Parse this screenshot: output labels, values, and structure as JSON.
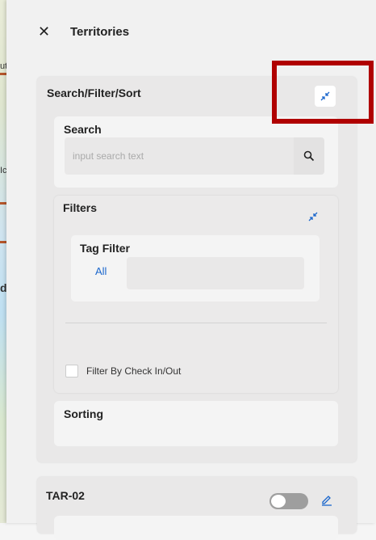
{
  "header": {
    "close_glyph": "✕",
    "title": "Territories"
  },
  "search_filter_sort": {
    "title": "Search/Filter/Sort",
    "collapse_icon": "collapse-arrows-icon",
    "search": {
      "label": "Search",
      "placeholder": "input search text",
      "button_icon": "search-icon"
    },
    "filters": {
      "label": "Filters",
      "collapse_icon": "collapse-arrows-icon",
      "tag_filter": {
        "label": "Tag Filter",
        "all_label": "All"
      },
      "check_in_out_label": "Filter By Check In/Out"
    },
    "sorting": {
      "label": "Sorting"
    }
  },
  "territory": {
    "name": "TAR-02",
    "toggle_on": false,
    "edit_icon": "pencil-icon"
  },
  "map_fragments": [
    "ut",
    "Ic",
    "d"
  ],
  "colors": {
    "accent": "#1a66cc",
    "highlight": "#b00000"
  }
}
